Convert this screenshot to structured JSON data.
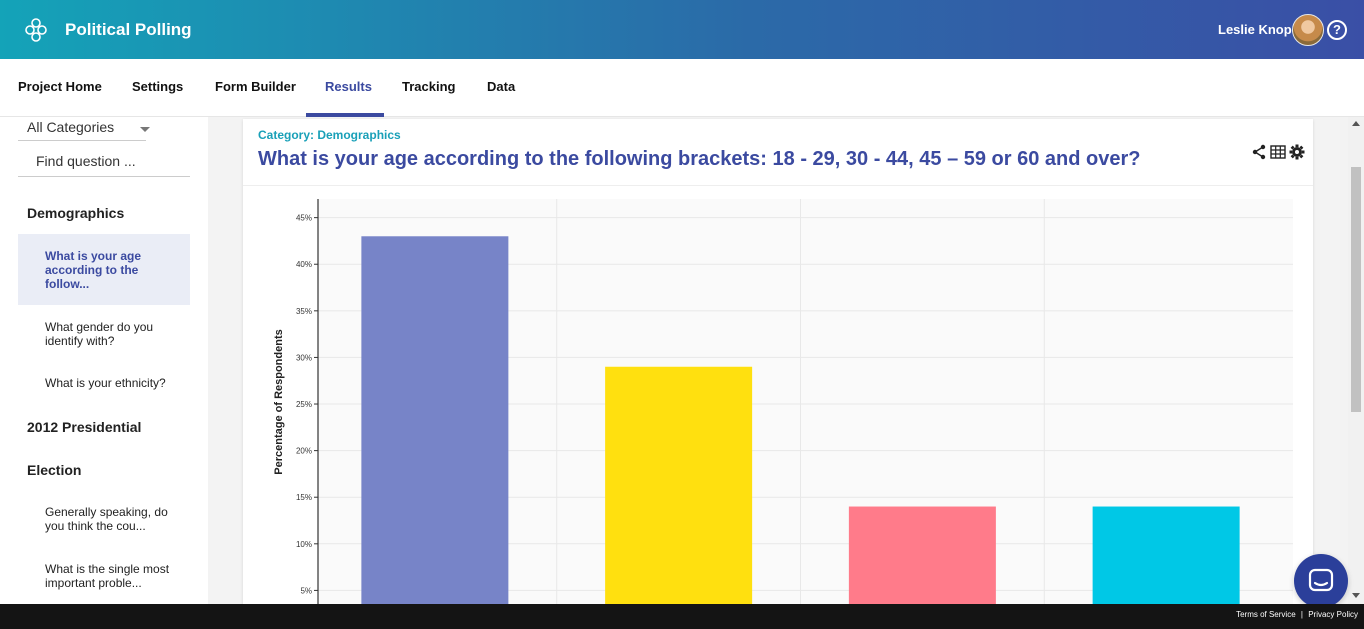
{
  "header": {
    "app_title": "Political Polling",
    "user_name": "Leslie Knope",
    "help_label": "?"
  },
  "nav": {
    "items": [
      {
        "label": "Project Home"
      },
      {
        "label": "Settings"
      },
      {
        "label": "Form Builder"
      },
      {
        "label": "Results",
        "active": true
      },
      {
        "label": "Tracking"
      },
      {
        "label": "Data"
      }
    ]
  },
  "sidebar": {
    "category_select": "All Categories",
    "find_placeholder": "Find question ...",
    "sections": [
      {
        "title": "Demographics",
        "questions": [
          {
            "label": "What is your age according to the follow...",
            "active": true
          },
          {
            "label": "What gender do you identify with?"
          },
          {
            "label": "What is your ethnicity?"
          }
        ]
      },
      {
        "title": "2012 Presidential",
        "title2": "Election",
        "questions": [
          {
            "label": "Generally speaking, do you think the cou..."
          },
          {
            "label": "What is the single most important proble..."
          }
        ]
      }
    ]
  },
  "card": {
    "category": "Category: Demographics",
    "question": "What is your age according to the following brackets: 18 - 29, 30 - 44, 45 – 59 or 60 and over?"
  },
  "chart_data": {
    "type": "bar",
    "ylabel": "Percentage of Respondents",
    "yticks": [
      "5%",
      "10%",
      "15%",
      "20%",
      "25%",
      "30%",
      "35%",
      "40%",
      "45%"
    ],
    "ylim": [
      0,
      47
    ],
    "grid": true,
    "values": [
      43,
      29,
      14,
      14
    ],
    "colors": [
      "#7784c8",
      "#ffe00f",
      "#ff7b8a",
      "#00c8e6"
    ]
  },
  "footer": {
    "terms": "Terms of Service",
    "separator": "|",
    "privacy": "Privacy Policy"
  }
}
